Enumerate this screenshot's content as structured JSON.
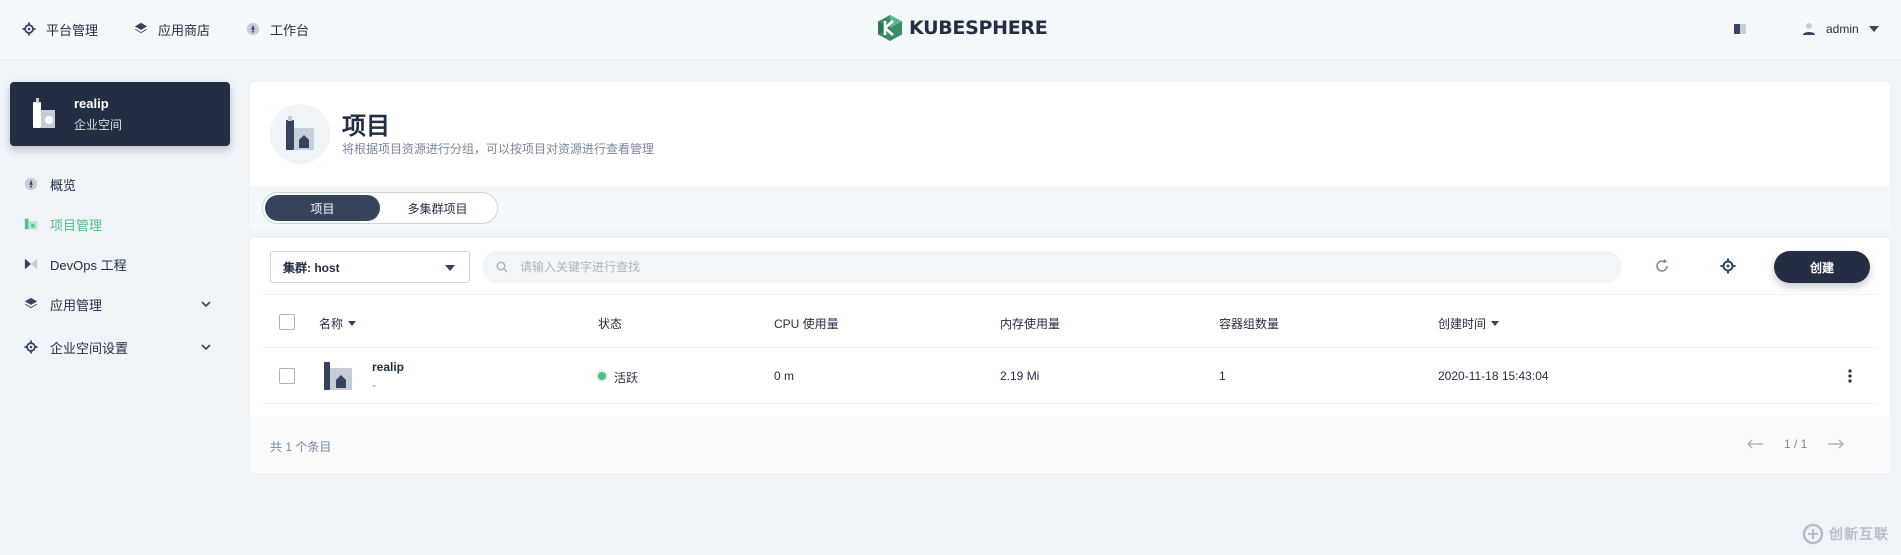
{
  "topnav": {
    "items": [
      {
        "label": "平台管理",
        "icon": "gear-icon"
      },
      {
        "label": "应用商店",
        "icon": "layers-icon"
      },
      {
        "label": "工作台",
        "icon": "compass-icon"
      }
    ],
    "logo_text": "KUBESPHERE",
    "user": "admin"
  },
  "workspace": {
    "name": "realip",
    "subtitle": "企业空间"
  },
  "sidebar": {
    "items": [
      {
        "label": "概览",
        "icon": "compass-icon",
        "active": false
      },
      {
        "label": "项目管理",
        "icon": "project-icon",
        "active": true
      },
      {
        "label": "DevOps 工程",
        "icon": "devops-icon",
        "active": false
      },
      {
        "label": "应用管理",
        "icon": "layers-icon",
        "active": false,
        "expandable": true
      },
      {
        "label": "企业空间设置",
        "icon": "gear-icon",
        "active": false,
        "expandable": true
      }
    ]
  },
  "banner": {
    "title": "项目",
    "description": "将根据项目资源进行分组，可以按项目对资源进行查看管理"
  },
  "tabs": [
    {
      "label": "项目",
      "active": true
    },
    {
      "label": "多集群项目",
      "active": false
    }
  ],
  "toolbar": {
    "cluster_select": "集群: host",
    "search_placeholder": "请输入关键字进行查找",
    "create_label": "创建"
  },
  "table": {
    "columns": [
      "名称",
      "状态",
      "CPU 使用量",
      "内存使用量",
      "容器组数量",
      "创建时间"
    ],
    "rows": [
      {
        "name": "realip",
        "description": "-",
        "status": "活跃",
        "cpu": "0 m",
        "memory": "2.19 Mi",
        "pods": "1",
        "created": "2020-11-18 15:43:04"
      }
    ]
  },
  "footer": {
    "total": "共 1 个条目",
    "page": "1 / 1"
  },
  "watermark": "创新互联",
  "colors": {
    "primary_dark": "#242e42",
    "active_green": "#55bc8a",
    "background": "#eff4f9"
  }
}
